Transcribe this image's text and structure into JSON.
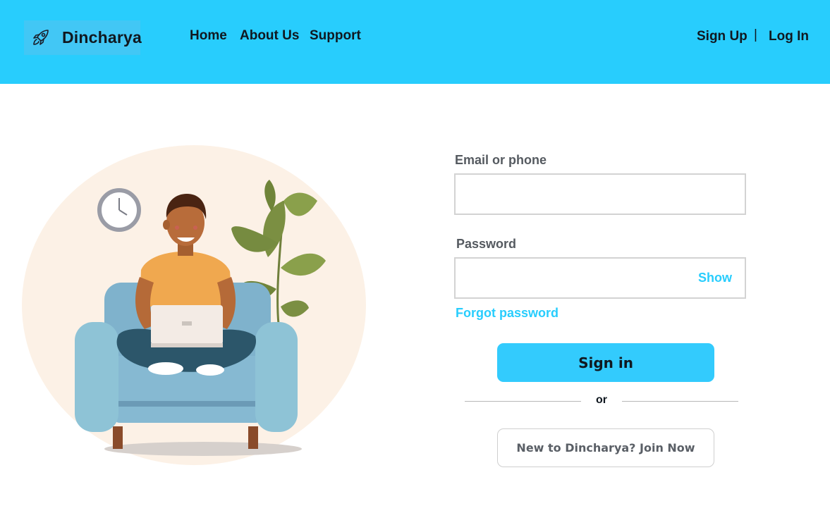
{
  "header": {
    "brand_name": "Dincharya",
    "brand_icon": "rocket-icon",
    "nav": {
      "home": "Home",
      "about": "About Us",
      "support": "Support"
    },
    "auth": {
      "signup": "Sign Up",
      "separator": "|",
      "login": "Log In"
    }
  },
  "illustration": {
    "subject": "person-with-laptop-on-armchair"
  },
  "form": {
    "email_label": "Email or phone",
    "email_value": "",
    "password_label": "Password",
    "password_value": "",
    "show_label": "Show",
    "forgot_label": "Forgot password",
    "signin_label": "Sign in",
    "divider_text": "or",
    "join_label": "New to Dincharya? Join Now"
  },
  "colors": {
    "header_bg": "#28cdfd",
    "accent": "#28cdfd",
    "primary_button": "#33cbfd"
  }
}
